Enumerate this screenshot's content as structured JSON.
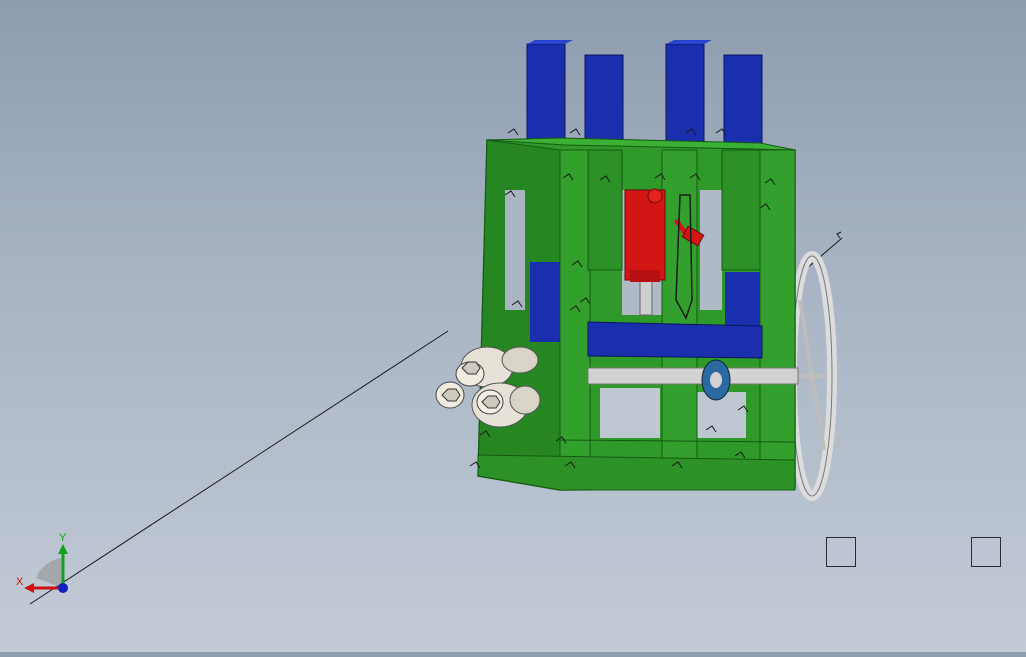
{
  "triad": {
    "x_label": "X",
    "y_label": "Y",
    "x_color": "#d01010",
    "y_color": "#10a020",
    "z_color": "#1020c0"
  },
  "colors": {
    "frame": "#2f9a2a",
    "frame_dark": "#1f6e1c",
    "post": "#1a2fae",
    "post_dark": "#0f1f80",
    "cylinder": "#d41515",
    "roller": "#e6e2d8",
    "shaft": "#c8c8c8",
    "bearing": "#2b6aa0"
  },
  "model": {
    "name": "hydraulic-bending-machine"
  }
}
